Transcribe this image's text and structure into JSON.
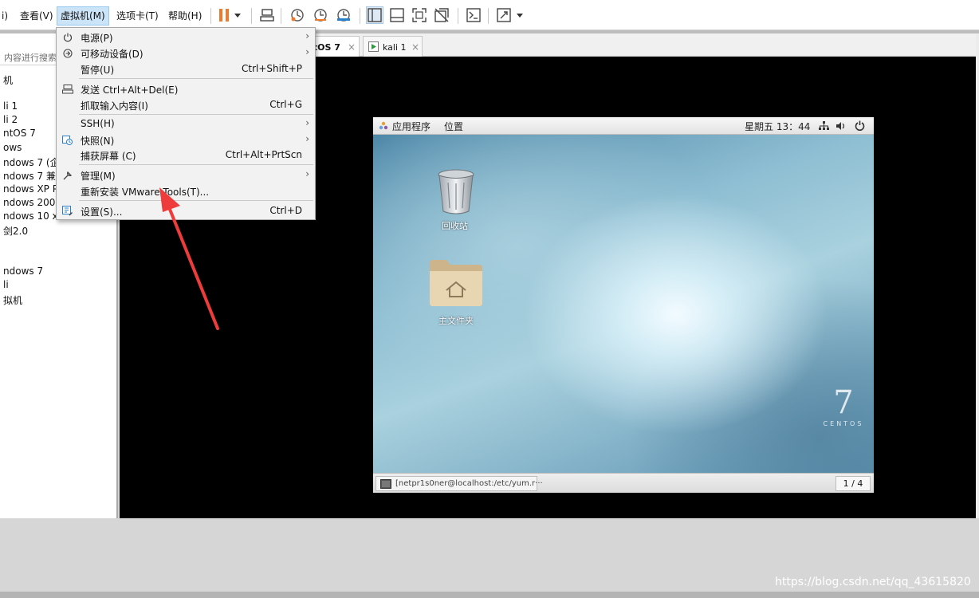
{
  "menubar": {
    "items": [
      "i)",
      "查看(V)",
      "虚拟机(M)",
      "选项卡(T)",
      "帮助(H)"
    ],
    "active_index": 2
  },
  "toolbar": {
    "icons": [
      "pause-icon",
      "dropdown-icon",
      "send-ctrl-alt-del-icon",
      "snapshot-icon",
      "revert-snapshot-icon",
      "snapshot-manager-icon",
      "show-library-icon",
      "thumbnail-bar-icon",
      "fullscreen-icon",
      "unity-icon",
      "console-view-icon",
      "stretch-icon",
      "stretch-dropdown-icon"
    ],
    "accent": "#f07a2b"
  },
  "library": {
    "search_placeholder": "内容进行搜索",
    "items": [
      "机",
      "li 1",
      "li 2",
      "ntOS 7",
      "ows",
      "ndows 7 (企",
      "ndows 7 兼",
      "ndows XP P",
      "ndows 200(",
      "ndows 10 x",
      "剑2.0",
      "ndows 7",
      "li",
      "拟机"
    ]
  },
  "tabs": [
    {
      "label": "ntOS 7",
      "active": true
    },
    {
      "label": "kali 1",
      "active": false
    }
  ],
  "vm_menu": {
    "items": [
      {
        "icon": "power-icon",
        "label": "电源(P)",
        "shortcut": "",
        "submenu": true
      },
      {
        "icon": "removable-devices-icon",
        "label": "可移动设备(D)",
        "shortcut": "",
        "submenu": true
      },
      {
        "icon": "",
        "label": "暂停(U)",
        "shortcut": "Ctrl+Shift+P",
        "submenu": false
      },
      {
        "icon": "keyboard-icon",
        "label": "发送 Ctrl+Alt+Del(E)",
        "shortcut": "",
        "submenu": false
      },
      {
        "icon": "",
        "label": "抓取输入内容(I)",
        "shortcut": "Ctrl+G",
        "submenu": false
      },
      {
        "icon": "",
        "label": "SSH(H)",
        "shortcut": "",
        "submenu": true
      },
      {
        "icon": "snapshot-icon",
        "label": "快照(N)",
        "shortcut": "",
        "submenu": true
      },
      {
        "icon": "",
        "label": "捕获屏幕 (C)",
        "shortcut": "Ctrl+Alt+PrtScn",
        "submenu": false
      },
      {
        "icon": "wrench-icon",
        "label": "管理(M)",
        "shortcut": "",
        "submenu": true
      },
      {
        "icon": "",
        "label": "重新安装 VMware Tools(T)...",
        "shortcut": "",
        "submenu": false
      },
      {
        "icon": "settings-icon",
        "label": "设置(S)...",
        "shortcut": "Ctrl+D",
        "submenu": false
      }
    ]
  },
  "guest": {
    "top_bar": {
      "applications": "应用程序",
      "places": "位置",
      "clock": "星期五 13：44"
    },
    "desktop_icons": [
      {
        "icon": "trash-icon",
        "label": "回收站"
      },
      {
        "icon": "home-folder-icon",
        "label": "主文件夹"
      }
    ],
    "centos_logo": {
      "number": "7",
      "word": "CENTOS"
    },
    "taskbar": {
      "window_title": "[netpr1s0ner@localhost:/etc/yum.r···",
      "workspace": "1 / 4"
    }
  },
  "watermark": "https://blog.csdn.net/qq_43615820"
}
